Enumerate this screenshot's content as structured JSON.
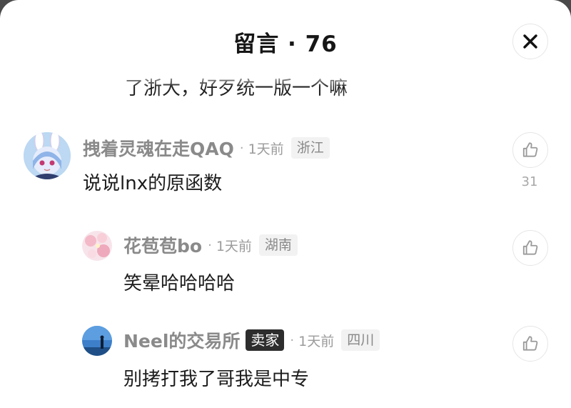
{
  "header": {
    "title": "留言 · 76"
  },
  "icons": {
    "close": "close-icon",
    "like": "thumbs-up-icon"
  },
  "previous_comment_tail": "了浙大，好歹统一版一个嘛",
  "comments": [
    {
      "username": "拽着灵魂在走QAQ",
      "dot": "·",
      "time": "1天前",
      "region": "浙江",
      "text": "说说lnx的原函数",
      "likes": "31",
      "avatar": "anime-bunny-avatar"
    },
    {
      "username": "花苞苞bo",
      "dot": "·",
      "time": "1天前",
      "region": "湖南",
      "text": "笑晕哈哈哈哈",
      "avatar": "pink-blossom-avatar"
    },
    {
      "username": "Neel的交易所",
      "badge": "卖家",
      "dot": "·",
      "time": "1天前",
      "region": "四川",
      "text": "别拷打我了哥我是中专",
      "avatar": "sky-photo-avatar"
    }
  ]
}
